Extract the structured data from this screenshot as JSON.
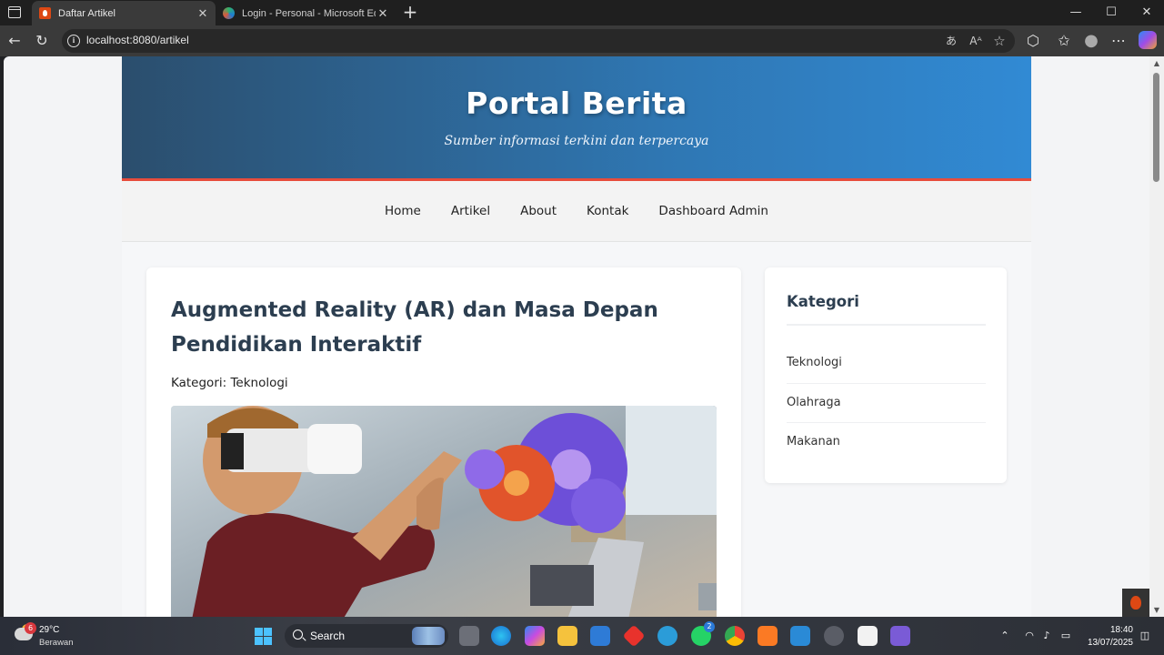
{
  "browser": {
    "tabs": [
      {
        "title": "Daftar Artikel",
        "active": true
      },
      {
        "title": "Login - Personal - Microsoft Edge",
        "active": false
      }
    ],
    "tab_close_glyph": "✕",
    "new_tab_glyph": "+",
    "window_controls": {
      "minimize": "—",
      "maximize": "☐",
      "close": "✕"
    },
    "nav": {
      "back": "←",
      "reload": "↻"
    },
    "address": "localhost:8080/artikel",
    "address_icons": {
      "translate": "あ",
      "read_aloud": "Aᴬ",
      "favorite": "☆"
    },
    "toolbar_icons": {
      "extensions": "⬡",
      "favorites": "✩",
      "profile": "●",
      "more": "⋯"
    }
  },
  "site": {
    "title": "Portal Berita",
    "tagline": "Sumber informasi terkini dan terpercaya",
    "nav": [
      "Home",
      "Artikel",
      "About",
      "Kontak",
      "Dashboard Admin"
    ],
    "article": {
      "title": "Augmented Reality (AR) dan Masa Depan Pendidikan Interaktif",
      "category": "Kategori: Teknologi",
      "image_alt": "boy-wearing-vr-headset-with-gears"
    },
    "sidebar": {
      "title": "Kategori",
      "items": [
        "Teknologi",
        "Olahraga",
        "Makanan"
      ]
    }
  },
  "taskbar": {
    "weather": {
      "temp": "29°C",
      "desc": "Berawan",
      "badge": "6"
    },
    "search_label": "Search",
    "whatsapp_badge": "2",
    "clock": {
      "time": "18:40",
      "date": "13/07/2025"
    }
  },
  "colors": {
    "header_gradient_start": "#2b4e6d",
    "header_gradient_end": "#318ad4",
    "accent_red": "#e74c3c",
    "heading_text": "#2c3e50"
  }
}
